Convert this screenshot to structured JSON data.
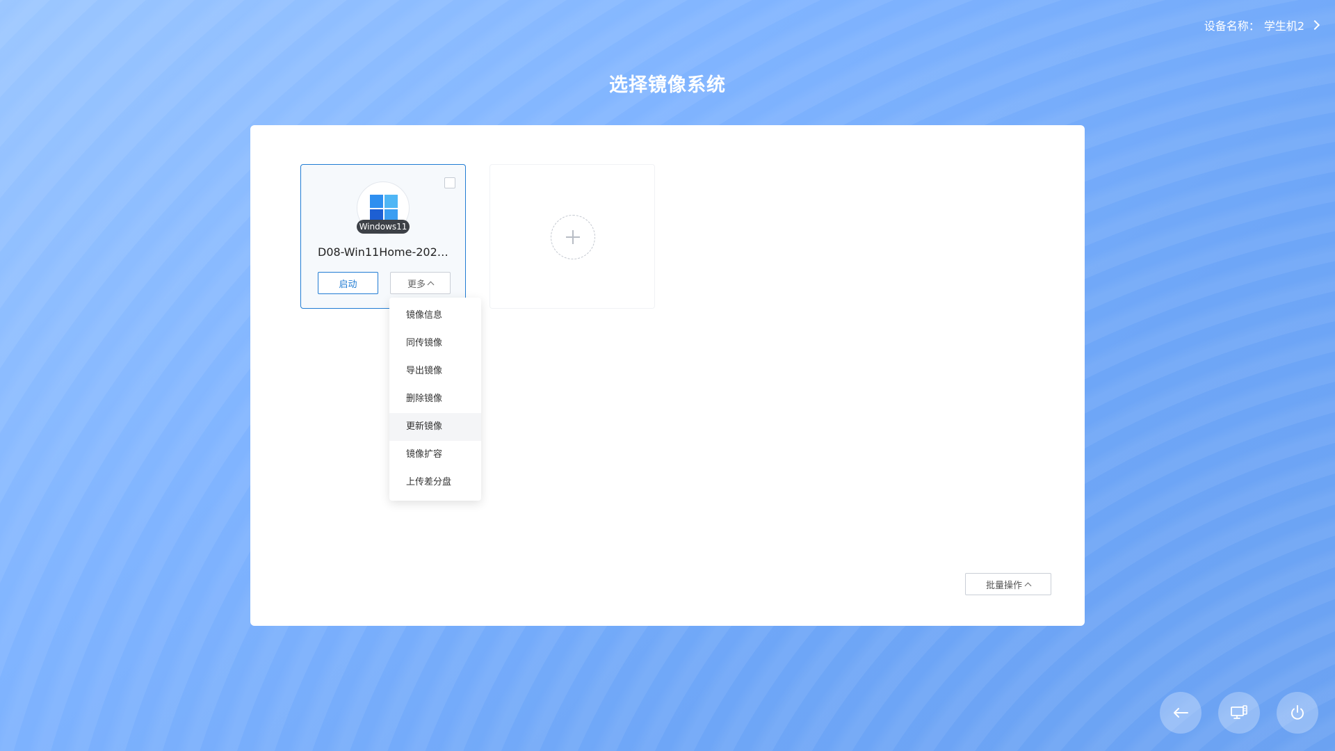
{
  "header": {
    "device_label": "设备名称：",
    "device_name": "学生机2"
  },
  "page": {
    "title": "选择镜像系统"
  },
  "image_card": {
    "os_badge": "Windows11",
    "name": "D08-Win11Home-2023...",
    "start_label": "启动",
    "more_label": "更多",
    "checked": false
  },
  "dropdown": {
    "items": [
      "镜像信息",
      "同传镜像",
      "导出镜像",
      "删除镜像",
      "更新镜像",
      "镜像扩容",
      "上传差分盘"
    ],
    "highlighted_index": 4
  },
  "batch": {
    "label": "批量操作"
  },
  "bottom_buttons": {
    "icons": [
      "arrow-left-icon",
      "monitor-settings-icon",
      "power-icon"
    ]
  },
  "colors": {
    "accent": "#1f7bd3",
    "background_start": "#9cc7ff",
    "background_end": "#6ba2f2"
  }
}
